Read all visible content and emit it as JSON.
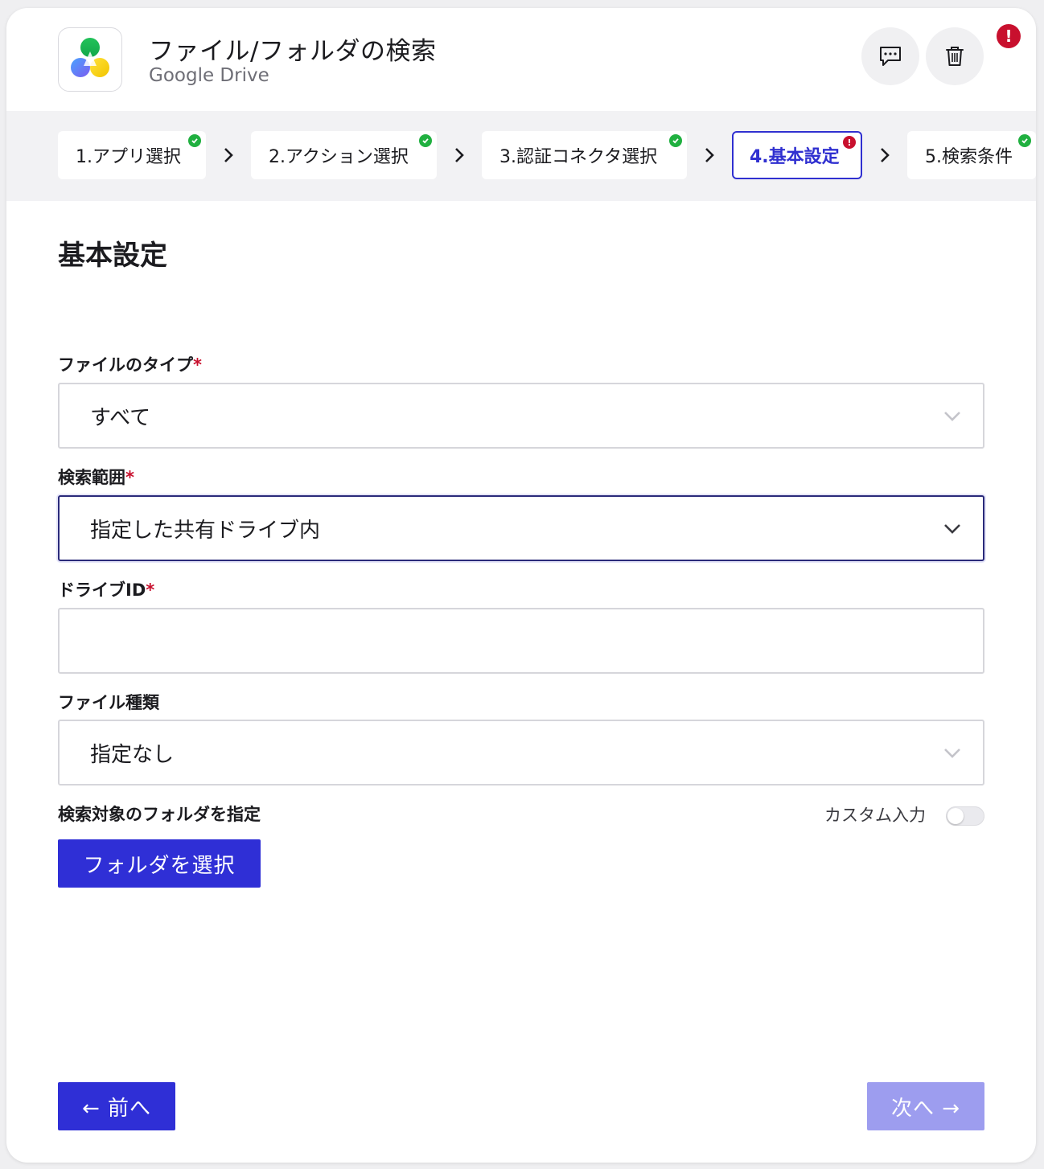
{
  "header": {
    "title": "ファイル/フォルダの検索",
    "subtitle": "Google Drive",
    "alert_badge": "!"
  },
  "steps": [
    {
      "label": "1.アプリ選択",
      "status": "complete"
    },
    {
      "label": "2.アクション選択",
      "status": "complete"
    },
    {
      "label": "3.認証コネクタ選択",
      "status": "complete"
    },
    {
      "label": "4.基本設定",
      "status": "error",
      "active": true
    },
    {
      "label": "5.検索条件",
      "status": "complete"
    }
  ],
  "section_title": "基本設定",
  "form": {
    "file_type": {
      "label": "ファイルのタイプ",
      "required_mark": "*",
      "value": "すべて"
    },
    "search_scope": {
      "label": "検索範囲",
      "required_mark": "*",
      "value": "指定した共有ドライブ内"
    },
    "drive_id": {
      "label": "ドライブID",
      "required_mark": "*",
      "value": ""
    },
    "file_kind": {
      "label": "ファイル種類",
      "value": "指定なし"
    },
    "target_folder": {
      "label": "検索対象のフォルダを指定",
      "custom_input_label": "カスタム入力",
      "custom_input_on": false,
      "button_label": "フォルダを選択"
    }
  },
  "footer": {
    "prev_label": "← 前へ",
    "next_label": "次へ →"
  },
  "colors": {
    "primary": "#2f2fd6",
    "primary_disabled": "#9d9def",
    "success": "#20b040",
    "error": "#c8102e"
  },
  "icons": [
    "google-drive-logo-icon",
    "comment-icon",
    "trash-icon",
    "alert-icon",
    "check-icon",
    "chevron-right-icon",
    "chevron-down-icon"
  ]
}
